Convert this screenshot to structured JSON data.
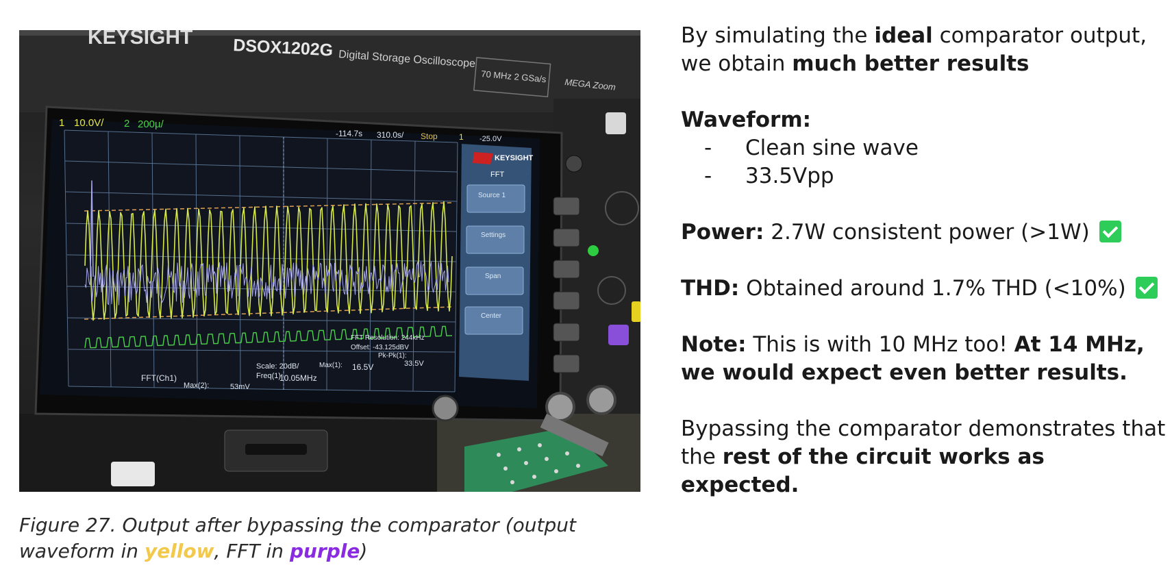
{
  "photo": {
    "brand": "KEYSIGHT",
    "model": "DSOX1202G",
    "model_desc": "Digital Storage Oscilloscope",
    "spec": "70 MHz  2 GSa/s",
    "megazoom": "MEGA Zoom",
    "ch1_scale": "10.0V/",
    "ch2_label": "2",
    "ch2_scale": "200µ/",
    "ch1_label": "1",
    "time_offset": "-114.7s",
    "time_scale": "310.0s/",
    "run_state": "Stop",
    "trig": "1",
    "trig_level": "-25.0V",
    "menu_brand": "KEYSIGHT",
    "menu_title": "FFT",
    "softkeys": [
      "Source 1",
      "Settings",
      "Span",
      "Center"
    ],
    "fft_resolution": "FFT Resolution: 244kHz",
    "fft_offset": "Offset: -43.125dBV",
    "pkpk_label": "Pk-Pk(1):",
    "pkpk_value": "33.5V",
    "scale": "Scale: 20dB/",
    "freq_label": "Freq(1):",
    "freq_value": "10.05MHz",
    "max1_label": "Max(1):",
    "max1_value": "16.5V",
    "max2_label": "Max(2):",
    "max2_value": "53mV",
    "fft_ch": "FFT(Ch1)"
  },
  "caption": {
    "before": "Figure 27. Output after bypassing the comparator (output waveform in ",
    "yellow": "yellow",
    "middle": ", FFT in ",
    "purple": "purple",
    "after": ")"
  },
  "right": {
    "intro_1": "By simulating the ",
    "intro_bold_1": "ideal",
    "intro_2": " comparator output, we obtain ",
    "intro_bold_2": "much better results",
    "waveform_heading": "Waveform:",
    "waveform_items": [
      "Clean sine wave",
      "33.5Vpp"
    ],
    "power_label": "Power:",
    "power_text": " 2.7W consistent power (>1W)",
    "thd_label": "THD:",
    "thd_text": " Obtained around 1.7% THD (<10%)",
    "note_label": "Note:",
    "note_text": " This is with 10 MHz too! ",
    "note_bold": "At 14 MHz, we would expect even better results.",
    "bypass_1": "Bypassing the comparator demonstrates that the ",
    "bypass_bold": "rest of the circuit works as expected."
  },
  "colors": {
    "yellow_trace": "#d7e84a",
    "green_trace": "#4bd34b",
    "purple_trace": "#a8a8f0",
    "check_green": "#2ecc58",
    "caption_yellow": "#f2c94c",
    "caption_purple": "#8a2be2"
  }
}
